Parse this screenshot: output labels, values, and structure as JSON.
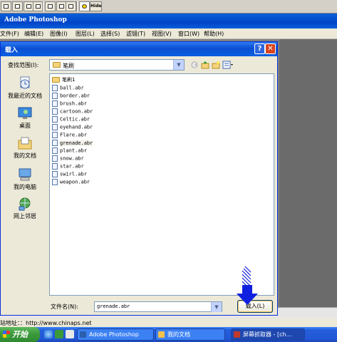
{
  "toolbar": {
    "buttons": [
      "tool-1",
      "tool-2",
      "tool-3",
      "tool-4",
      "tool-5",
      "tool-6",
      "tool-7"
    ],
    "hide_label": "Hide"
  },
  "photoshop": {
    "title": "Adobe Photoshop",
    "menu": [
      "文件(F)",
      "编辑(E)",
      "图像(I)",
      "图层(L)",
      "选择(S)",
      "滤镜(T)",
      "视图(V)",
      "窗口(W)",
      "帮助(H)"
    ]
  },
  "dialog": {
    "title": "载入",
    "help_glyph": "?",
    "close_glyph": "✕",
    "look_in_label": "查找范围(I):",
    "look_in_value": "笔刷",
    "places": [
      "我最近的文档",
      "桌面",
      "我的文档",
      "我的电脑",
      "网上邻居"
    ],
    "folder": "笔刷1",
    "files": [
      "ball.abr",
      "border.abr",
      "brush.abr",
      "cartoon.abr",
      "Celtic.abr",
      "eyehand.abr",
      "Flare.abr",
      "grenade.abr",
      "plant.abr",
      "snow.abr",
      "star.abr",
      "swirl.abr",
      "weapon.abr"
    ],
    "selected_file": "grenade.abr",
    "file_name_label": "文件名(N):",
    "file_name_value": "grenade.abr",
    "load_button": "载入(L)"
  },
  "status": {
    "address": "站地址：：http://www.chinaps.net"
  },
  "taskbar": {
    "start_label": "开始",
    "tasks": [
      {
        "label": "Adobe Photoshop",
        "icon_color": "#2a5fae"
      },
      {
        "label": "我的文档",
        "icon_color": "#f2c14e"
      },
      {
        "label": "屏幕抓取器 - [ch…",
        "icon_color": "#c0392b"
      }
    ]
  },
  "colors": {
    "xp_blue": "#0a5fd8",
    "dialog_face": "#ece9d8",
    "arrow_blue": "#1020e0"
  }
}
